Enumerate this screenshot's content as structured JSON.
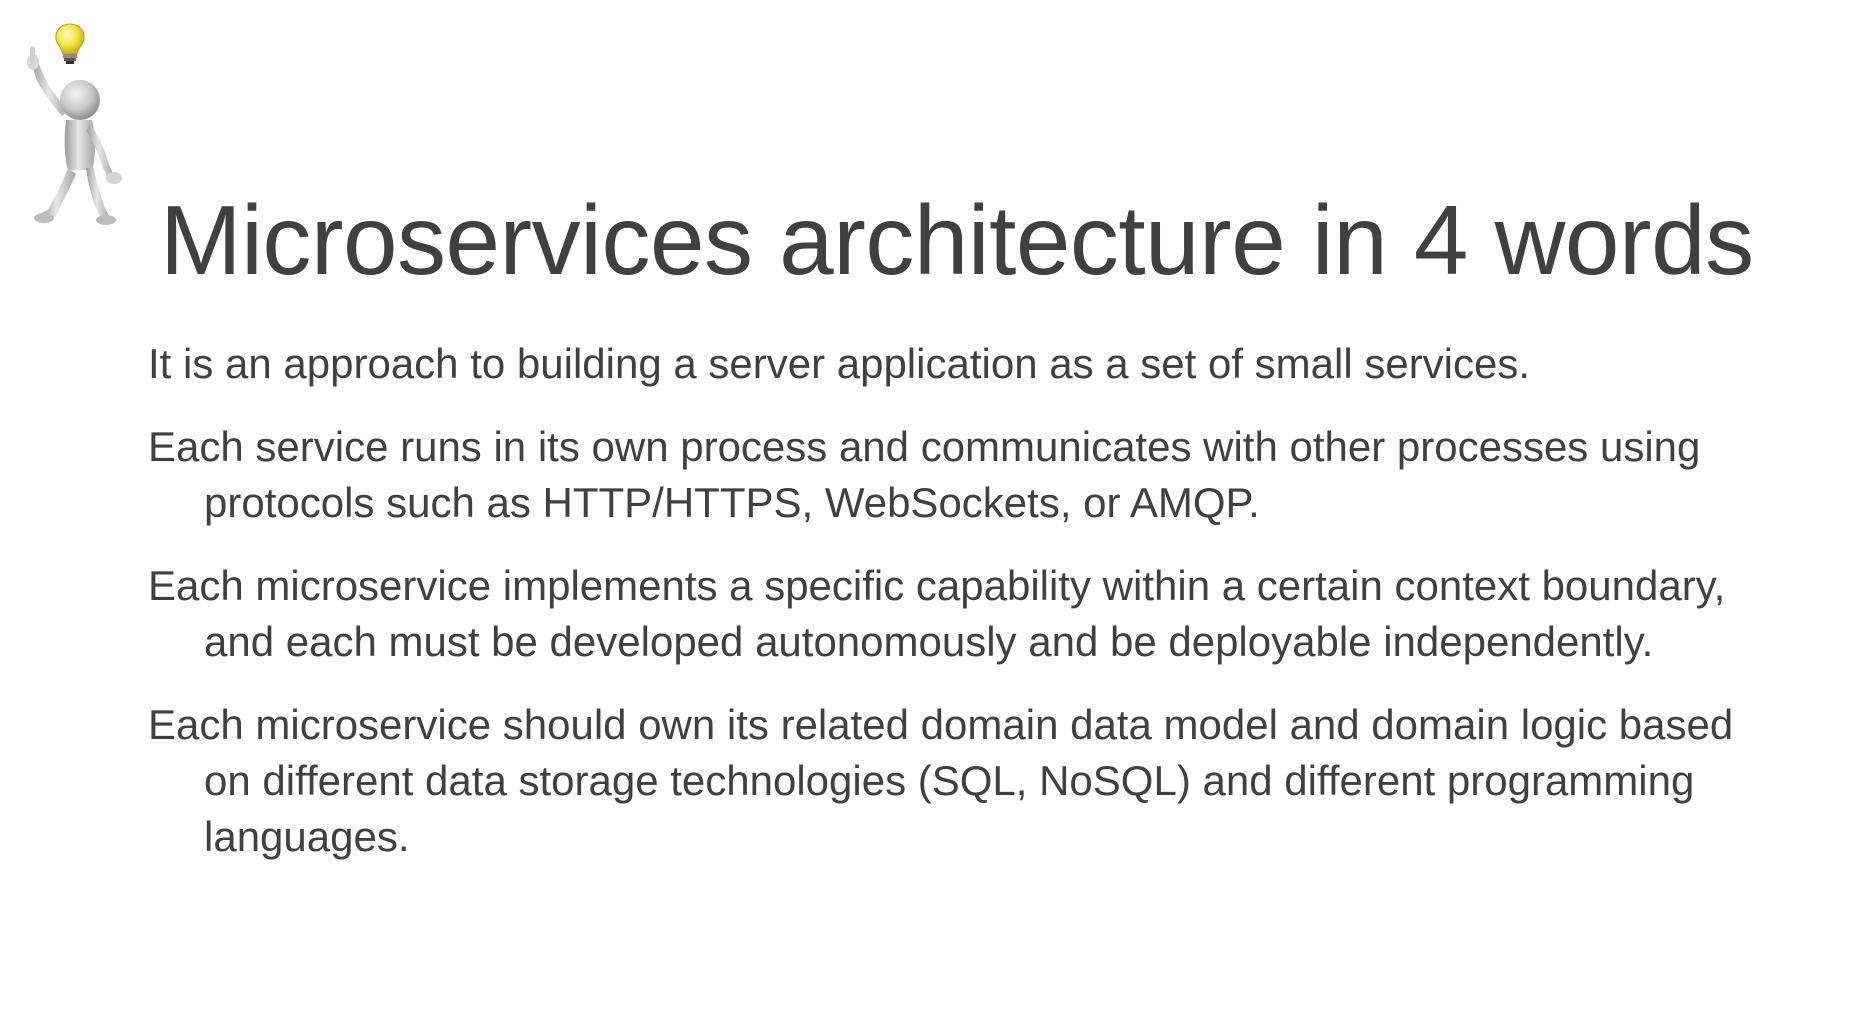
{
  "slide": {
    "title": "Microservices architecture in 4 words",
    "clipart_icon": "stick-figure-lightbulb-idea-icon",
    "bullets": [
      {
        "text": "It is an approach to building a server application as a set of small services."
      },
      {
        "text": "Each service runs in its own process and communicates with other processes using protocols such as HTTP/HTTPS, WebSockets, or AMQP."
      },
      {
        "text": "Each microservice implements a specific capability within a certain context boundary, and each must be developed autonomously and be deployable independently."
      },
      {
        "text": "Each microservice should own its related domain data model and domain logic based on different data storage technologies (SQL, NoSQL) and different programming languages."
      }
    ]
  },
  "colors": {
    "text": "#404040",
    "background": "#ffffff",
    "bulb": "#f5e23a",
    "figure": "#c8c8c8"
  }
}
